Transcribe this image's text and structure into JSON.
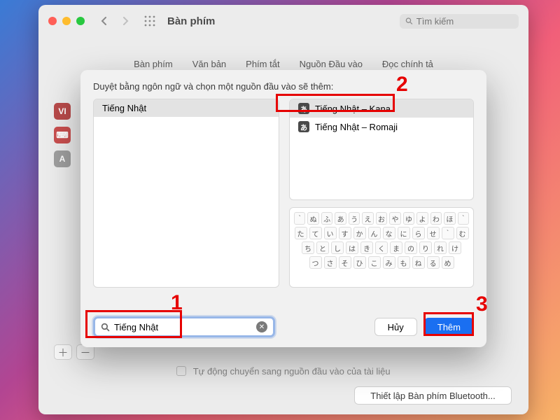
{
  "window": {
    "title": "Bàn phím",
    "search_placeholder": "Tìm kiếm"
  },
  "tabs": [
    "Bàn phím",
    "Văn bản",
    "Phím tắt",
    "Nguồn Đầu vào",
    "Đọc chính tả"
  ],
  "below_checkbox_text": "Tự động chuyển sang nguồn đầu vào của tài liệu",
  "bluetooth_button": "Thiết lập Bàn phím Bluetooth...",
  "sheet": {
    "message": "Duyệt bằng ngôn ngữ và chọn một nguồn đầu vào sẽ thêm:",
    "languages": [
      "Tiếng Nhật"
    ],
    "sources": [
      {
        "label": "Tiếng Nhật – Kana",
        "selected": true
      },
      {
        "label": "Tiếng Nhật – Romaji",
        "selected": false
      }
    ],
    "keyboard_rows": [
      [
        "`",
        "ぬ",
        "ふ",
        "あ",
        "う",
        "え",
        "お",
        "や",
        "ゆ",
        "よ",
        "わ",
        "ほ",
        "`"
      ],
      [
        "た",
        "て",
        "い",
        "す",
        "か",
        "ん",
        "な",
        "に",
        "ら",
        "せ",
        "`",
        "む"
      ],
      [
        "ち",
        "と",
        "し",
        "は",
        "き",
        "く",
        "ま",
        "の",
        "り",
        "れ",
        "け"
      ],
      [
        "つ",
        "さ",
        "そ",
        "ひ",
        "こ",
        "み",
        "も",
        "ね",
        "る",
        "め"
      ]
    ],
    "search_value": "Tiếng Nhật",
    "cancel": "Hủy",
    "add": "Thêm"
  },
  "annotations": {
    "n1": "1",
    "n2": "2",
    "n3": "3"
  }
}
